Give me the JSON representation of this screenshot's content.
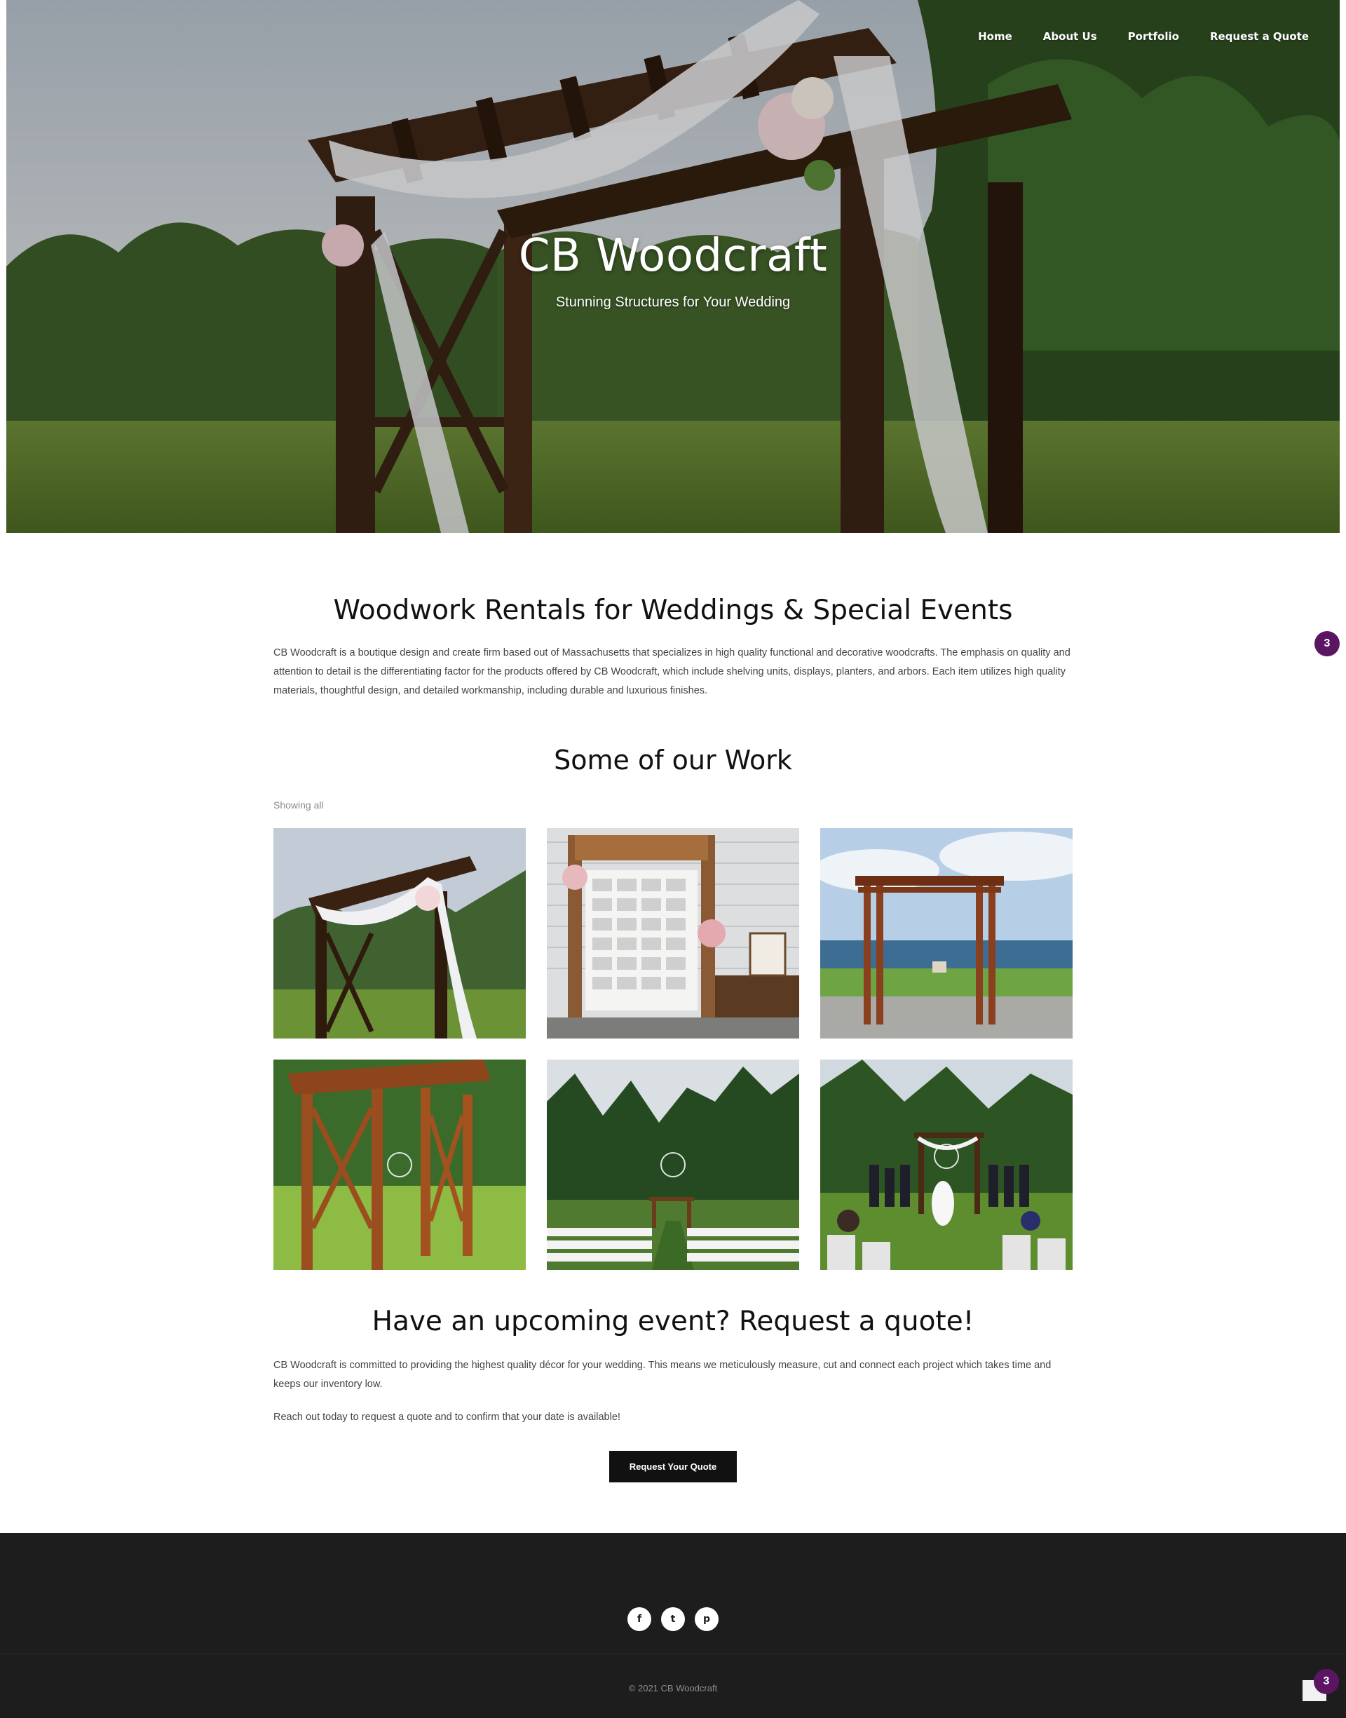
{
  "nav": {
    "items": [
      "Home",
      "About Us",
      "Portfolio",
      "Request a Quote"
    ]
  },
  "hero": {
    "title": "CB Woodcraft",
    "subtitle": "Stunning Structures for Your Wedding"
  },
  "about": {
    "heading": "Woodwork Rentals for Weddings & Special Events",
    "body": "CB Woodcraft is a boutique design and create firm based out of Massachusetts that specializes in high quality functional and decorative woodcrafts. The emphasis on quality and attention to detail is the differentiating factor for the products offered by CB Woodcraft, which include shelving units, displays, planters, and arbors. Each item utilizes high quality materials, thoughtful design, and detailed workmanship, including durable and luxurious finishes."
  },
  "work": {
    "heading": "Some of our Work",
    "filter_text": "Showing all"
  },
  "quote": {
    "heading": "Have an upcoming event? Request a quote!",
    "body1": "CB Woodcraft is committed to providing the highest quality décor for your wedding. This means we meticulously measure, cut and connect each project which takes time and keeps our inventory low.",
    "body2": "Reach out today to request a quote and to confirm that your date is available!",
    "button_label": "Request Your Quote"
  },
  "badges": {
    "side_count": "3",
    "corner_count": "3"
  },
  "footer": {
    "social_icons": [
      "facebook-icon",
      "twitter-icon",
      "pinterest-icon"
    ],
    "social_glyphs": [
      "f",
      "t",
      "p"
    ],
    "copyright": "© 2021 CB Woodcraft"
  },
  "colors": {
    "badge": "#5b1563",
    "footer_bg": "#1d1d1d",
    "button_bg": "#111111"
  }
}
